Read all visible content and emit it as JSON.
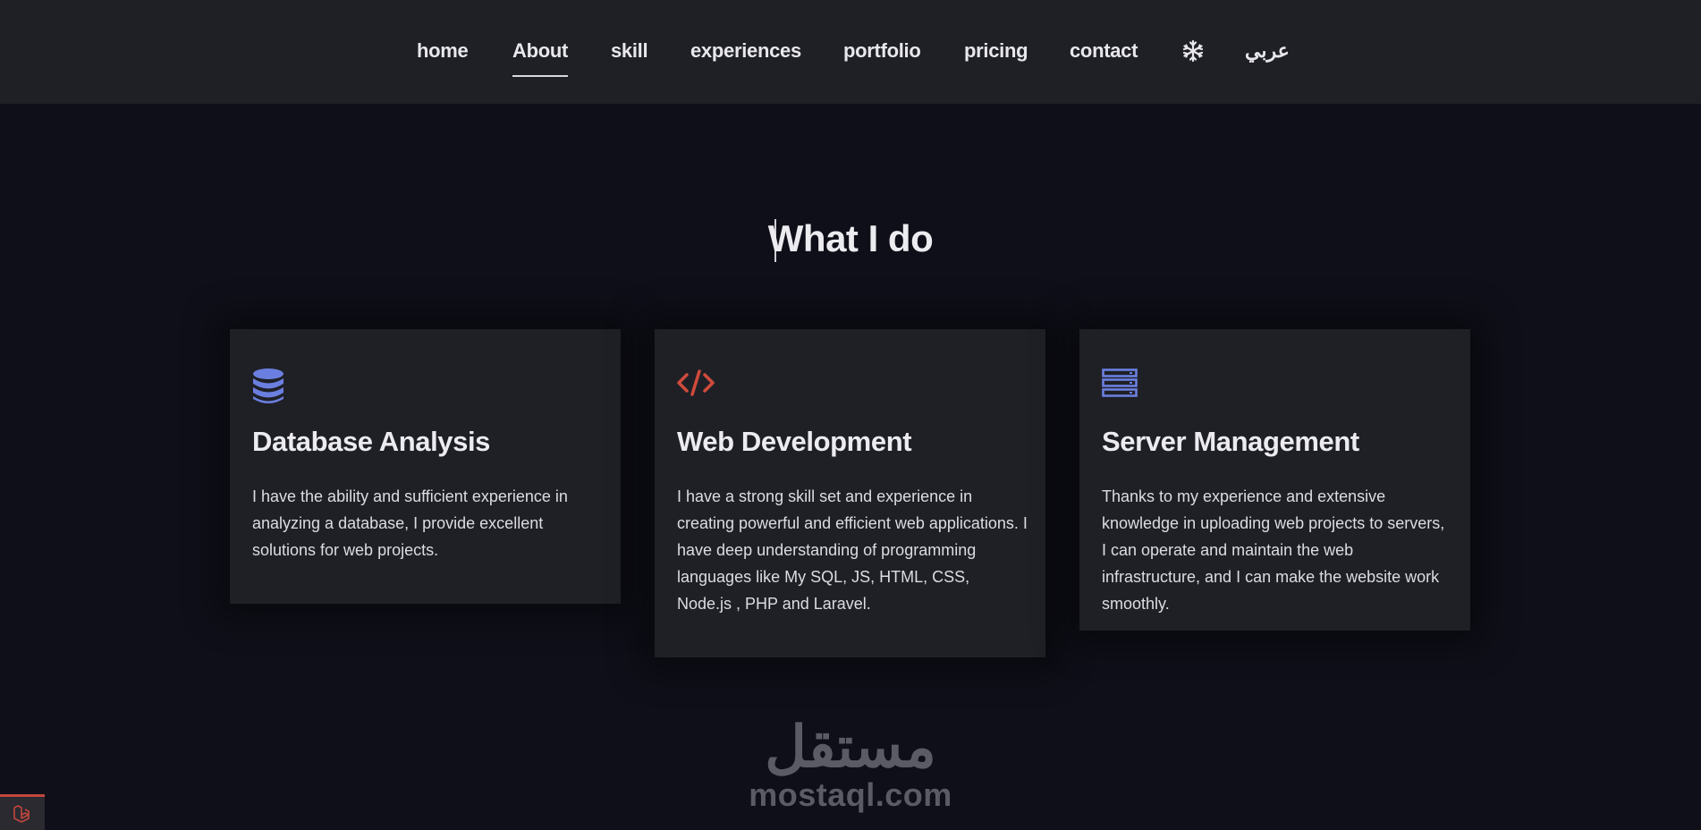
{
  "nav": {
    "items": [
      {
        "label": "home"
      },
      {
        "label": "About"
      },
      {
        "label": "skill"
      },
      {
        "label": "experiences"
      },
      {
        "label": "portfolio"
      },
      {
        "label": "pricing"
      },
      {
        "label": "contact"
      }
    ],
    "theme_icon": "snowflake-icon",
    "language_label": "عربي",
    "active": "About"
  },
  "section": {
    "title": "What I do"
  },
  "services": [
    {
      "icon": "database-icon",
      "icon_color": "#6b7fe0",
      "title": "Database Analysis",
      "description": "I have the ability and sufficient experience in analyzing a database, I provide excellent solutions for web projects."
    },
    {
      "icon": "code-icon",
      "icon_color": "#d04b3c",
      "title": "Web Development",
      "description": "I have a strong skill set and experience in creating powerful and efficient web applications. I have deep understanding of programming languages like My SQL, JS, HTML, CSS, Node.js , PHP and Laravel."
    },
    {
      "icon": "server-icon",
      "icon_color": "#6b7fe0",
      "title": "Server Management",
      "description": "Thanks to my experience and extensive knowledge in uploading web projects to servers, I can operate and maintain the web infrastructure, and I can make the website work smoothly."
    }
  ],
  "watermark": {
    "arabic": "مستقل",
    "latin": "mostaql.com"
  },
  "corner_badge_icon": "laravel-icon",
  "colors": {
    "accent_red": "#c2473d",
    "accent_blue": "#6b7fe0",
    "background": "#0f0f19",
    "card": "#1f2026"
  }
}
